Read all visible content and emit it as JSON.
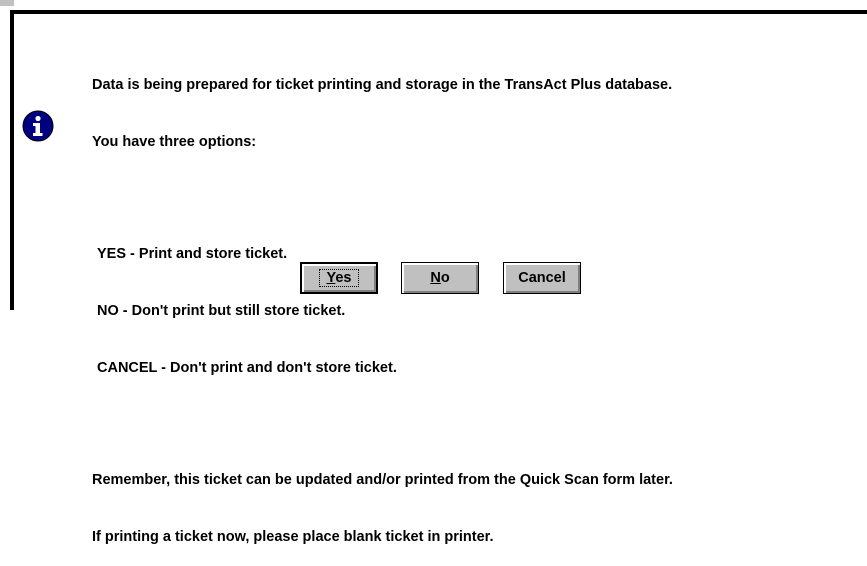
{
  "dialog": {
    "message": {
      "intro_line1": "Data is being prepared for ticket printing and storage in the TransAct Plus database.",
      "intro_line2": "You have three options:",
      "options": [
        "YES - Print and store ticket.",
        "NO - Don't print but still store ticket.",
        "CANCEL - Don't print and don't store ticket."
      ],
      "remember_line1": "Remember, this ticket can be updated and/or printed from the Quick Scan form later.",
      "remember_line2": "If printing a ticket now, please place blank ticket in printer."
    },
    "icon": "information-icon",
    "buttons": {
      "yes": {
        "mnemonic": "Y",
        "rest": "es"
      },
      "no": {
        "mnemonic": "N",
        "rest": "o"
      },
      "cancel": {
        "label": "Cancel"
      }
    },
    "colors": {
      "face": "#c0c0c0",
      "icon_blue": "#000080",
      "frame": "#000000"
    }
  }
}
